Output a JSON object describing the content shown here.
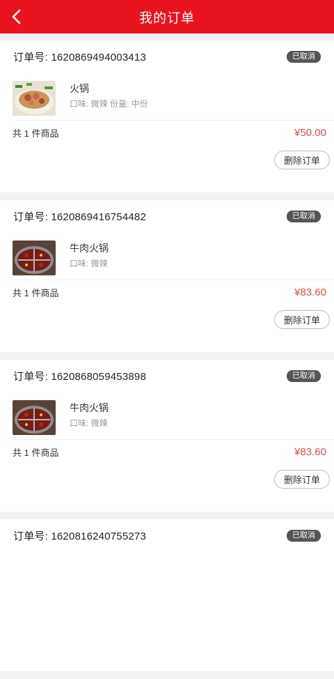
{
  "header": {
    "title": "我的订单",
    "back_icon": "chevron-left-icon"
  },
  "colors": {
    "brand": "#e8141f",
    "price": "#e04b43",
    "badge": "#555555"
  },
  "orders": [
    {
      "order_label": "订单号: 1620869494003413",
      "status": "已取消",
      "item_name": "火锅",
      "item_spec": "口味: 微辣 份量: 中份",
      "count": "共 1 件商品",
      "price": "¥50.00",
      "delete_label": "删除订单"
    },
    {
      "order_label": "订单号: 1620869416754482",
      "status": "已取消",
      "item_name": "牛肉火锅",
      "item_spec": "口味: 微辣",
      "count": "共 1 件商品",
      "price": "¥83.60",
      "delete_label": "删除订单"
    },
    {
      "order_label": "订单号: 1620868059453898",
      "status": "已取消",
      "item_name": "牛肉火锅",
      "item_spec": "口味: 微辣",
      "count": "共 1 件商品",
      "price": "¥83.60",
      "delete_label": "删除订单"
    },
    {
      "order_label": "订单号: 1620816240755273",
      "status": "已取消"
    }
  ]
}
